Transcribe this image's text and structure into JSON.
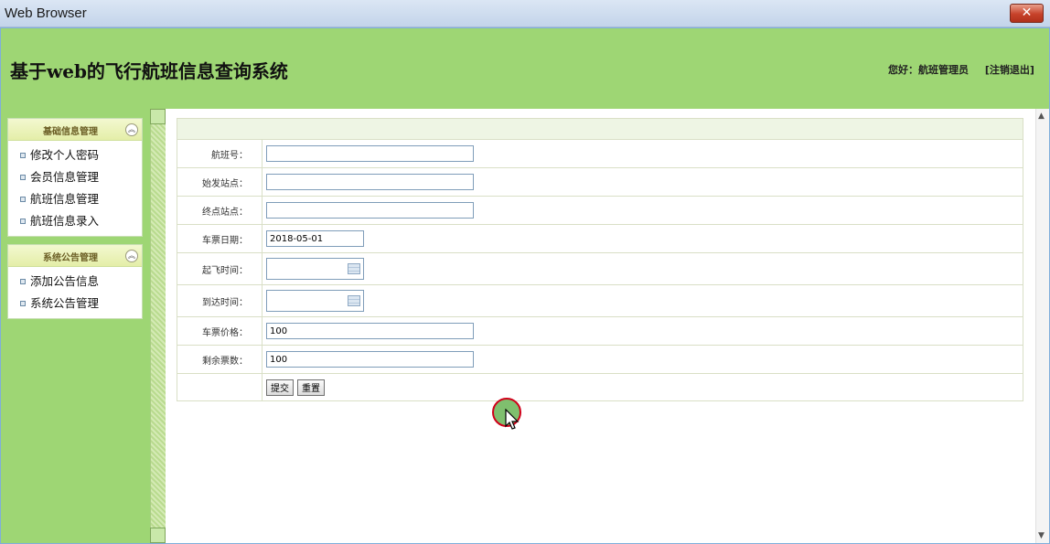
{
  "window": {
    "title": "Web Browser",
    "close_glyph": "✕"
  },
  "header": {
    "system_title": "基于web的飞行航班信息查询系统",
    "greeting": "您好：航班管理员",
    "logout": "[注销退出]"
  },
  "sidebar": {
    "panels": [
      {
        "title": "基础信息管理",
        "items": [
          "修改个人密码",
          "会员信息管理",
          "航班信息管理",
          "航班信息录入"
        ]
      },
      {
        "title": "系统公告管理",
        "items": [
          "添加公告信息",
          "系统公告管理"
        ]
      }
    ]
  },
  "form": {
    "fields": [
      {
        "label": "航班号：",
        "value": ""
      },
      {
        "label": "始发站点：",
        "value": ""
      },
      {
        "label": "终点站点：",
        "value": ""
      },
      {
        "label": "车票日期：",
        "value": "2018-05-01"
      },
      {
        "label": "起飞时间：",
        "value": ""
      },
      {
        "label": "到达时间：",
        "value": ""
      },
      {
        "label": "车票价格：",
        "value": "100"
      },
      {
        "label": "剩余票数：",
        "value": "100"
      }
    ],
    "submit_label": "提交",
    "reset_label": "重置"
  },
  "icons": {
    "collapse": "chevron-up-icon",
    "calendar": "calendar-icon",
    "cursor": "mouse-pointer-icon"
  },
  "colors": {
    "page_green": "#9ed674",
    "cursor_ring": "#d0001a"
  }
}
